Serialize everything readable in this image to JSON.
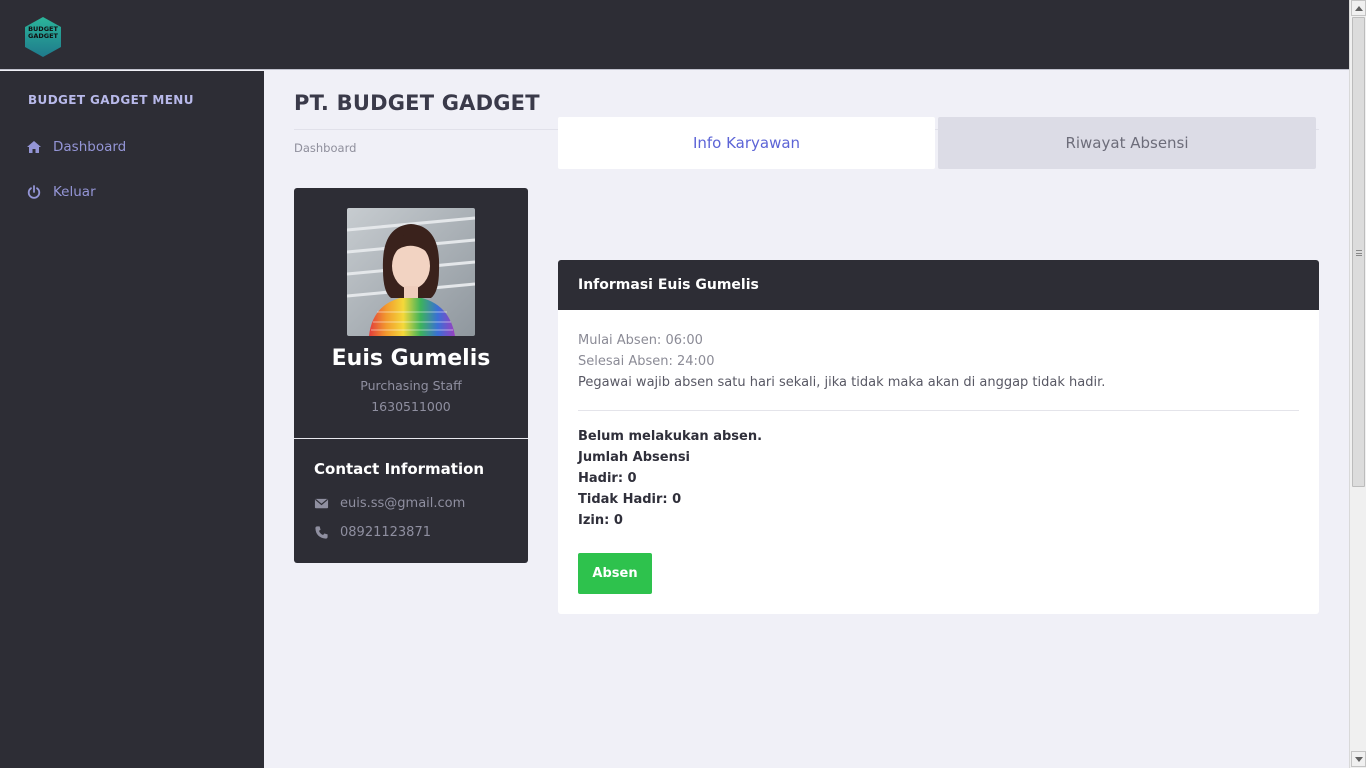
{
  "brand": {
    "logo_text_line1": "BUDGET",
    "logo_text_line2": "GADGET",
    "colors": {
      "logo_top": "#2bb59a",
      "logo_bottom": "#1f7a8c"
    }
  },
  "sidebar": {
    "title": "BUDGET GADGET MENU",
    "items": [
      {
        "label": "Dashboard",
        "icon": "home-icon"
      },
      {
        "label": "Keluar",
        "icon": "power-icon"
      }
    ]
  },
  "main": {
    "title": "PT. BUDGET GADGET",
    "breadcrumb": "Dashboard"
  },
  "profile": {
    "name": "Euis Gumelis",
    "role": "Purchasing Staff",
    "id": "1630511000",
    "contact_title": "Contact Information",
    "email": "euis.ss@gmail.com",
    "phone": "08921123871"
  },
  "tabs": [
    {
      "label": "Info Karyawan",
      "active": true
    },
    {
      "label": "Riwayat Absensi",
      "active": false
    }
  ],
  "info_panel": {
    "title": "Informasi Euis Gumelis",
    "mulai": "Mulai Absen: 06:00",
    "selesai": "Selesai Absen: 24:00",
    "note": "Pegawai wajib absen satu hari sekali, jika tidak maka akan di anggap tidak hadir.",
    "status": "Belum melakukan absen.",
    "jumlah_label": "Jumlah Absensi",
    "hadir": "Hadir: 0",
    "tidak_hadir": "Tidak Hadir: 0",
    "izin": "Izin: 0",
    "button_label": "Absen"
  },
  "colors": {
    "dark": "#2d2d35",
    "accent": "#5c64d6",
    "success": "#2ec24d",
    "muted": "#8f8fa0"
  }
}
